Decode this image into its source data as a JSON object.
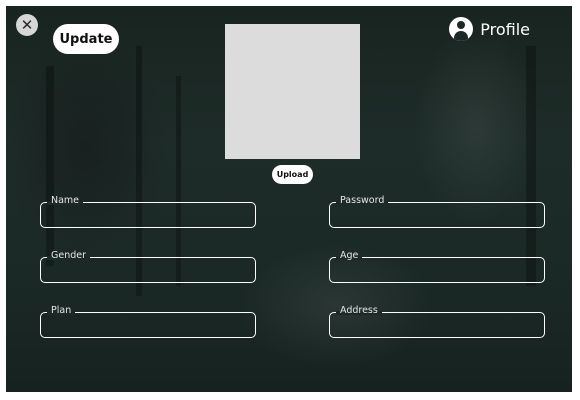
{
  "toolbar": {
    "close_icon": "close-icon",
    "update_label": "Update",
    "profile_label": "Profile",
    "profile_icon": "user-circle-icon"
  },
  "photo": {
    "upload_label": "Upload"
  },
  "form": {
    "fields": [
      {
        "label": "Name",
        "value": ""
      },
      {
        "label": "Password",
        "value": ""
      },
      {
        "label": "Gender",
        "value": ""
      },
      {
        "label": "Age",
        "value": ""
      },
      {
        "label": "Plan",
        "value": ""
      },
      {
        "label": "Address",
        "value": ""
      }
    ]
  },
  "colors": {
    "background": "#1c2a27",
    "accent": "#ffffff",
    "photo_placeholder": "#dcdcdc"
  }
}
